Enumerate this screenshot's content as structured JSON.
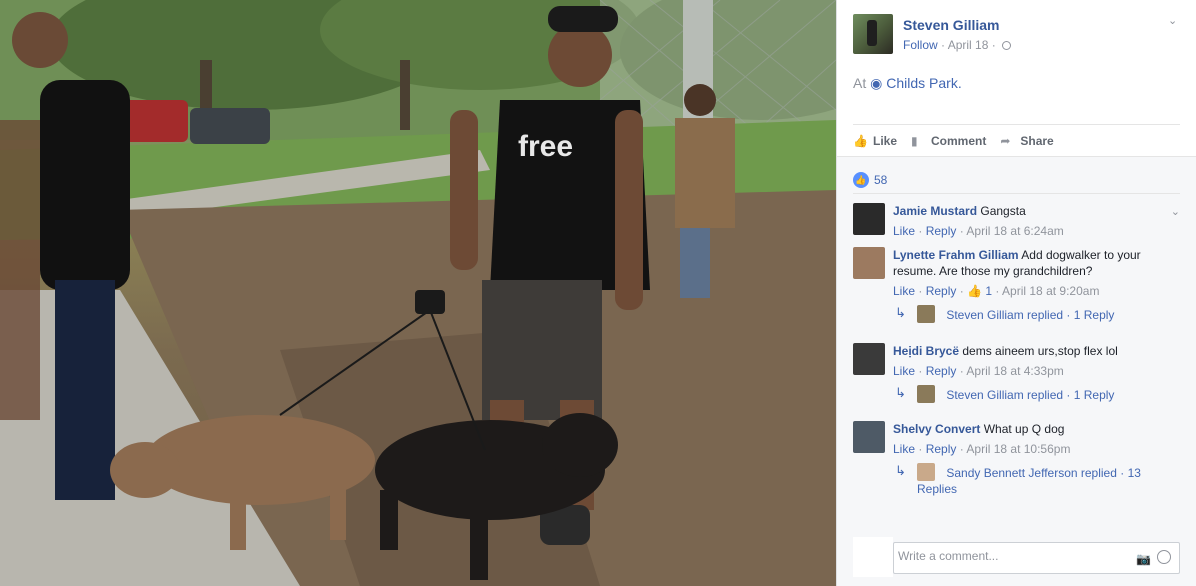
{
  "post": {
    "author": "Steven Gilliam",
    "follow_label": "Follow",
    "date": "April 18",
    "location_prefix": "At",
    "place": "Childs Park."
  },
  "actions": {
    "like": "Like",
    "comment": "Comment",
    "share": "Share"
  },
  "reactions": {
    "count": "58"
  },
  "comments": [
    {
      "author": "Jamie Mustard",
      "text": "Gangsta",
      "like": "Like",
      "reply": "Reply",
      "time": "April 18 at 6:24am"
    },
    {
      "author": "Lynette Frahm Gilliam",
      "text": "Add dogwalker to your resume. Are those my grandchildren?",
      "like": "Like",
      "reply": "Reply",
      "like_count": "1",
      "time": "April 18 at 9:20am",
      "replies": {
        "who": "Steven Gilliam replied",
        "count": "1 Reply"
      }
    },
    {
      "author": "Heịdi Brycë",
      "text": "dems aineem urs,stop flex lol",
      "like": "Like",
      "reply": "Reply",
      "time": "April 18 at 4:33pm",
      "replies": {
        "who": "Steven Gilliam replied",
        "count": "1 Reply"
      }
    },
    {
      "author": "Shelvy Convert",
      "text": "What up Q dog",
      "like": "Like",
      "reply": "Reply",
      "time": "April 18 at 10:56pm",
      "replies": {
        "who": "Sandy Bennett Jefferson replied",
        "count": "13 Replies"
      }
    }
  ],
  "composer": {
    "placeholder": "Write a comment..."
  },
  "photo": {
    "shirt_text": "free"
  },
  "colors": {
    "link": "#365899",
    "accent": "#4267b2",
    "muted": "#90949c",
    "panel_bg": "#f6f7f9"
  }
}
